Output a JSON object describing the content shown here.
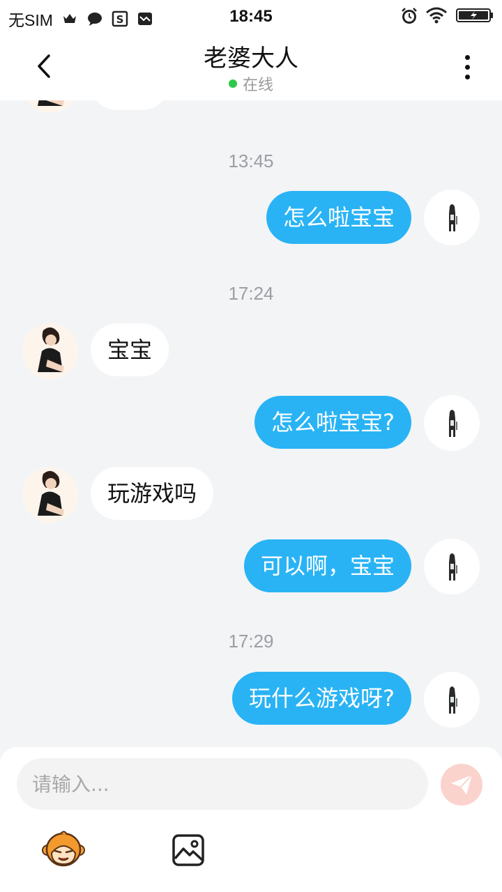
{
  "status_bar": {
    "carrier": "无SIM",
    "time": "18:45",
    "icons_left": [
      "crown-icon",
      "chat-bubble-icon",
      "s-box-icon",
      "mail-icon"
    ],
    "icons_right": [
      "alarm-icon",
      "wifi-icon",
      "battery-charging-icon"
    ]
  },
  "header": {
    "title": "老婆大人",
    "status": "在线",
    "status_color": "#2ec84a"
  },
  "conversation": [
    {
      "type": "time",
      "text": "13:45"
    },
    {
      "type": "msg",
      "dir": "out",
      "text": "怎么啦宝宝"
    },
    {
      "type": "time",
      "text": "17:24"
    },
    {
      "type": "msg",
      "dir": "in",
      "text": "宝宝"
    },
    {
      "type": "msg",
      "dir": "out",
      "text": "怎么啦宝宝?"
    },
    {
      "type": "msg",
      "dir": "in",
      "text": "玩游戏吗"
    },
    {
      "type": "msg",
      "dir": "out",
      "text": "可以啊，宝宝"
    },
    {
      "type": "time",
      "text": "17:29"
    },
    {
      "type": "msg",
      "dir": "out",
      "text": "玩什么游戏呀?"
    }
  ],
  "input": {
    "placeholder": "请输入..."
  },
  "colors": {
    "outgoing_bubble": "#29b3f5",
    "incoming_bubble": "#ffffff",
    "background": "#f3f4f6",
    "send_button": "#fbd3cd"
  }
}
